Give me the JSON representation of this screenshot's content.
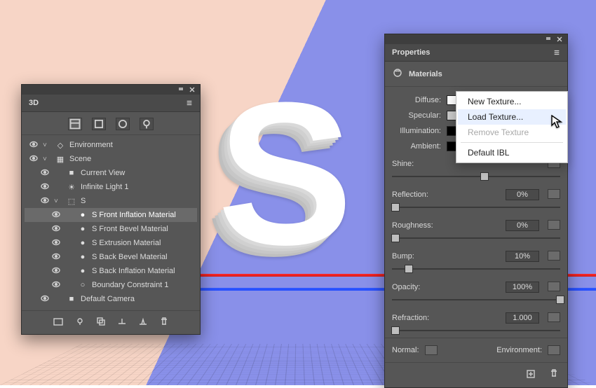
{
  "panel3d": {
    "title": "3D",
    "tree": [
      {
        "vis": "●",
        "twist": "˅",
        "icon": "env",
        "label": "Environment"
      },
      {
        "vis": "●",
        "twist": "˅",
        "icon": "scene",
        "label": "Scene"
      },
      {
        "vis": "● ",
        "twist": "",
        "icon": "camera",
        "label": "Current View"
      },
      {
        "vis": "●",
        "twist": "",
        "icon": "light",
        "label": "Infinite Light 1"
      },
      {
        "vis": "●",
        "twist": "˅",
        "icon": "mesh",
        "label": "S"
      },
      {
        "vis": "●",
        "twist": "",
        "icon": "material",
        "label": "S Front Inflation Material",
        "selected": true
      },
      {
        "vis": "●",
        "twist": "",
        "icon": "material",
        "label": "S Front Bevel Material"
      },
      {
        "vis": "●",
        "twist": "",
        "icon": "material",
        "label": "S Extrusion Material"
      },
      {
        "vis": "●",
        "twist": "",
        "icon": "material",
        "label": "S Back Bevel Material"
      },
      {
        "vis": "●",
        "twist": "",
        "icon": "material",
        "label": "S Back Inflation Material"
      },
      {
        "vis": "●",
        "twist": "",
        "icon": "constraint",
        "label": "Boundary Constraint 1"
      },
      {
        "vis": "●",
        "twist": "",
        "icon": "camera",
        "label": "Default Camera"
      }
    ]
  },
  "properties": {
    "title": "Properties",
    "section": "Materials",
    "labels": {
      "diffuse": "Diffuse:",
      "specular": "Specular:",
      "illumination": "Illumination:",
      "ambient": "Ambient:",
      "shine": "Shine:",
      "reflection": "Reflection:",
      "roughness": "Roughness:",
      "bump": "Bump:",
      "opacity": "Opacity:",
      "refraction": "Refraction:",
      "normal": "Normal:",
      "environment": "Environment:"
    },
    "values": {
      "shine": "",
      "reflection": "0%",
      "roughness": "0%",
      "bump": "10%",
      "opacity": "100%",
      "refraction": "1.000"
    },
    "slider_pos": {
      "shine": 0.55,
      "reflection": 0.02,
      "roughness": 0.02,
      "bump": 0.1,
      "opacity": 1.0,
      "refraction": 0.02
    }
  },
  "context_menu": {
    "items": [
      {
        "label": "New Texture...",
        "state": "normal"
      },
      {
        "label": "Load Texture...",
        "state": "active"
      },
      {
        "label": "Remove Texture",
        "state": "disabled"
      },
      {
        "label": "Default IBL",
        "state": "normal",
        "sep_before": true
      }
    ]
  }
}
